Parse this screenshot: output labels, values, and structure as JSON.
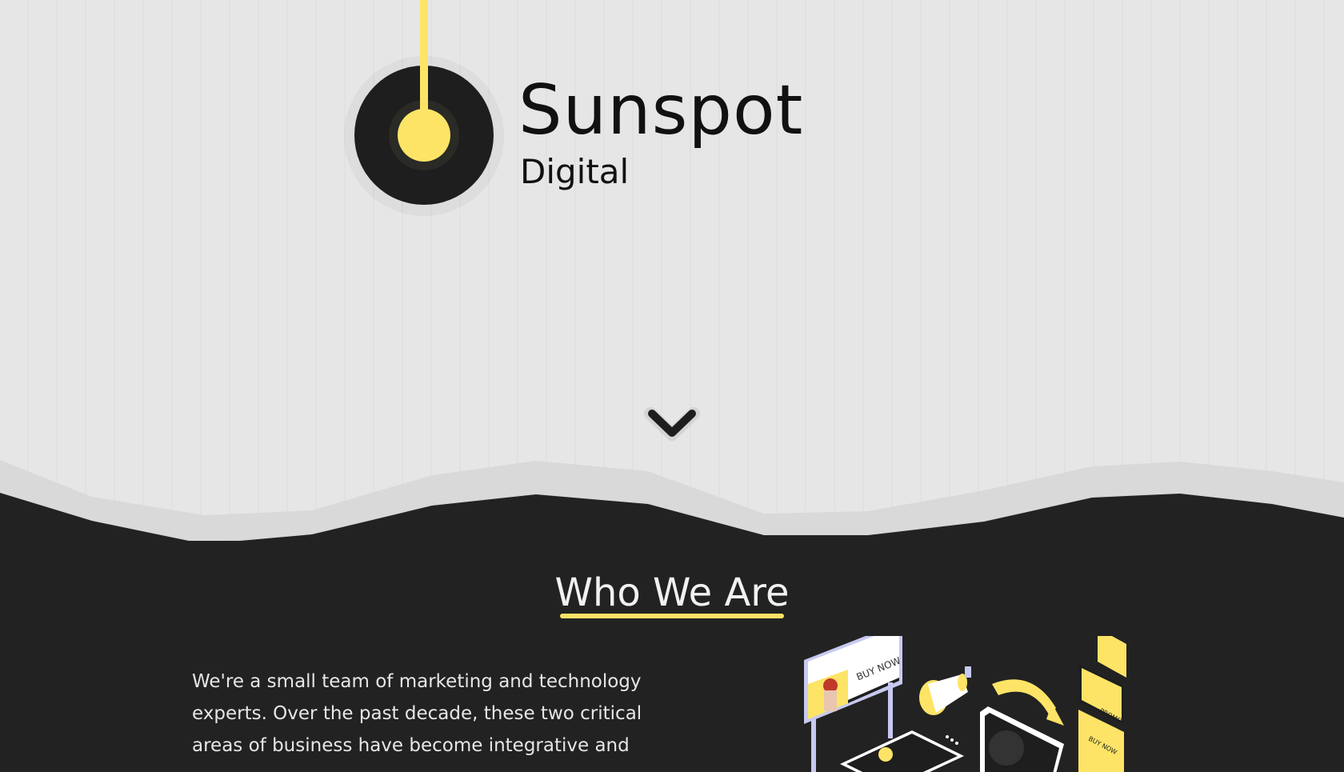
{
  "brand": {
    "name": "Sunspot",
    "subtitle": "Digital"
  },
  "scroll": {
    "icon": "chevron-down-icon"
  },
  "about": {
    "title": "Who We Are",
    "paragraph_lines": [
      "We're a small team of marketing and technology",
      "experts. Over the past decade, these two critical",
      "areas of business have become integrative and"
    ],
    "illustration_labels": {
      "billboard": "BUY NOW",
      "promo_card_1": "PROMO",
      "promo_card_2": "BUY NOW"
    }
  },
  "colors": {
    "accent": "#fde466",
    "dark": "#222222",
    "light_bg": "#e6e6e6"
  }
}
